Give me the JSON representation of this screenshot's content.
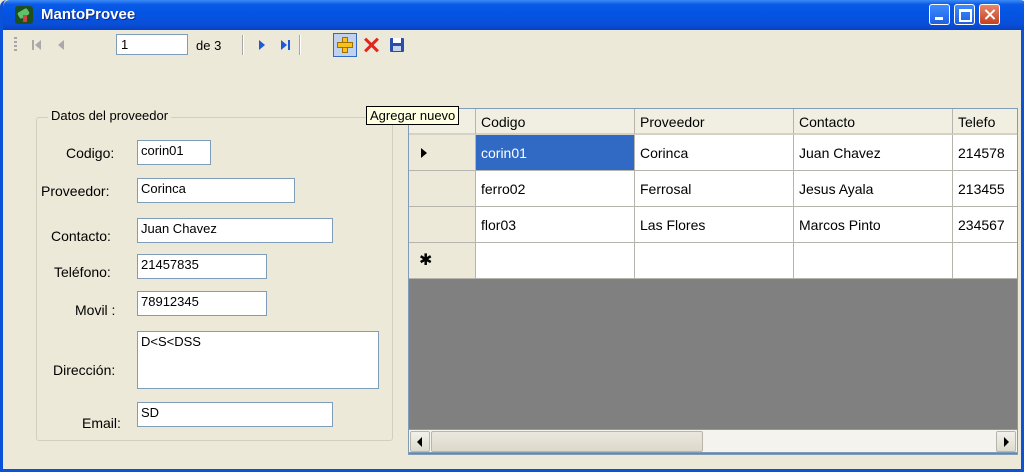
{
  "window": {
    "title": "MantoProvee"
  },
  "toolbar": {
    "position_value": "1",
    "count_label": "de 3",
    "tooltip": "Agregar nuevo"
  },
  "form": {
    "group_title": "Datos del proveedor",
    "fields": [
      {
        "label": "Codigo:",
        "value": "corin01"
      },
      {
        "label": "Proveedor:",
        "value": "Corinca"
      },
      {
        "label": "Contacto:",
        "value": "Juan Chavez"
      },
      {
        "label": "Teléfono:",
        "value": "21457835"
      },
      {
        "label": "Movil :",
        "value": "78912345"
      },
      {
        "label": "Dirección:",
        "value": "D<S<DSS"
      },
      {
        "label": "Email:",
        "value": "SD"
      }
    ]
  },
  "grid": {
    "columns": [
      "Codigo",
      "Proveedor",
      "Contacto",
      "Telefo"
    ],
    "rows": [
      [
        "corin01",
        "Corinca",
        "Juan Chavez",
        "214578"
      ],
      [
        "ferro02",
        "Ferrosal",
        "Jesus Ayala",
        "213455"
      ],
      [
        "flor03",
        "Las Flores",
        "Marcos Pinto",
        "234567"
      ]
    ],
    "new_row_marker": "✱"
  }
}
